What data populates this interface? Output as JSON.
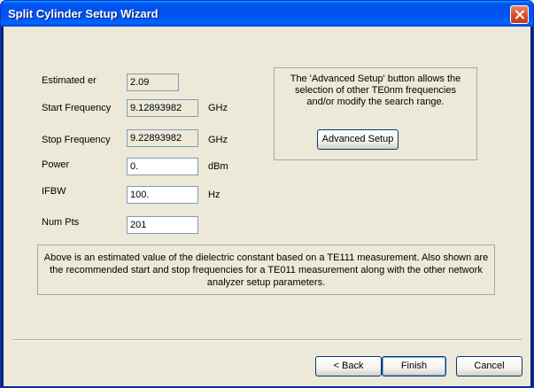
{
  "window": {
    "title": "Split Cylinder Setup Wizard"
  },
  "fields": {
    "estimated_er": {
      "label": "Estimated er",
      "value": "2.09"
    },
    "start_frequency": {
      "label": "Start Frequency",
      "value": "9.12893982",
      "unit": "GHz"
    },
    "stop_frequency": {
      "label": "Stop Frequency",
      "value": "9.22893982",
      "unit": "GHz"
    },
    "power": {
      "label": "Power",
      "value": "0.",
      "unit": "dBm"
    },
    "ifbw": {
      "label": "IFBW",
      "value": "100.",
      "unit": "Hz"
    },
    "num_pts": {
      "label": "Num Pts",
      "value": "201"
    }
  },
  "advanced": {
    "text": "The 'Advanced Setup' button allows the selection of other TE0nm frequencies and/or modify the search range.",
    "button_label": "Advanced Setup"
  },
  "info": {
    "text": "Above is an estimated value of the dielectric constant based on a TE111 measurement.  Also shown are the recommended start and stop frequencies for a TE011 measurement along with the other network analyzer setup parameters."
  },
  "buttons": {
    "back_label": "< Back",
    "finish_label": "Finish",
    "cancel_label": "Cancel"
  },
  "colors": {
    "titlebar": "#0053ee",
    "face": "#ece9d8",
    "close": "#d9512c"
  }
}
